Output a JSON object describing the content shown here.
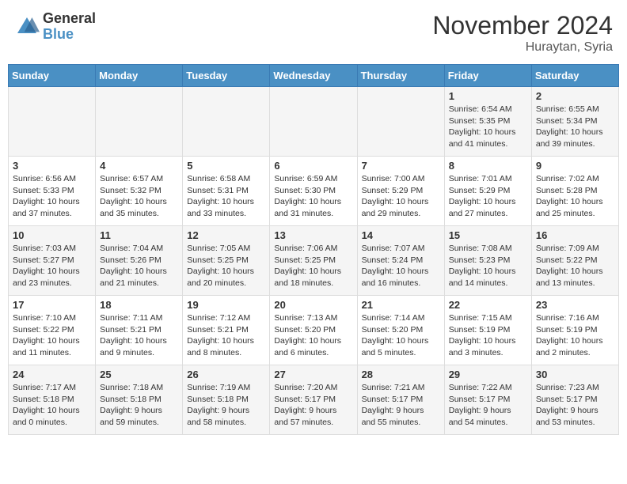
{
  "header": {
    "logo_general": "General",
    "logo_blue": "Blue",
    "month_title": "November 2024",
    "location": "Huraytan, Syria"
  },
  "weekdays": [
    "Sunday",
    "Monday",
    "Tuesday",
    "Wednesday",
    "Thursday",
    "Friday",
    "Saturday"
  ],
  "weeks": [
    [
      {
        "day": "",
        "info": ""
      },
      {
        "day": "",
        "info": ""
      },
      {
        "day": "",
        "info": ""
      },
      {
        "day": "",
        "info": ""
      },
      {
        "day": "",
        "info": ""
      },
      {
        "day": "1",
        "info": "Sunrise: 6:54 AM\nSunset: 5:35 PM\nDaylight: 10 hours and 41 minutes."
      },
      {
        "day": "2",
        "info": "Sunrise: 6:55 AM\nSunset: 5:34 PM\nDaylight: 10 hours and 39 minutes."
      }
    ],
    [
      {
        "day": "3",
        "info": "Sunrise: 6:56 AM\nSunset: 5:33 PM\nDaylight: 10 hours and 37 minutes."
      },
      {
        "day": "4",
        "info": "Sunrise: 6:57 AM\nSunset: 5:32 PM\nDaylight: 10 hours and 35 minutes."
      },
      {
        "day": "5",
        "info": "Sunrise: 6:58 AM\nSunset: 5:31 PM\nDaylight: 10 hours and 33 minutes."
      },
      {
        "day": "6",
        "info": "Sunrise: 6:59 AM\nSunset: 5:30 PM\nDaylight: 10 hours and 31 minutes."
      },
      {
        "day": "7",
        "info": "Sunrise: 7:00 AM\nSunset: 5:29 PM\nDaylight: 10 hours and 29 minutes."
      },
      {
        "day": "8",
        "info": "Sunrise: 7:01 AM\nSunset: 5:29 PM\nDaylight: 10 hours and 27 minutes."
      },
      {
        "day": "9",
        "info": "Sunrise: 7:02 AM\nSunset: 5:28 PM\nDaylight: 10 hours and 25 minutes."
      }
    ],
    [
      {
        "day": "10",
        "info": "Sunrise: 7:03 AM\nSunset: 5:27 PM\nDaylight: 10 hours and 23 minutes."
      },
      {
        "day": "11",
        "info": "Sunrise: 7:04 AM\nSunset: 5:26 PM\nDaylight: 10 hours and 21 minutes."
      },
      {
        "day": "12",
        "info": "Sunrise: 7:05 AM\nSunset: 5:25 PM\nDaylight: 10 hours and 20 minutes."
      },
      {
        "day": "13",
        "info": "Sunrise: 7:06 AM\nSunset: 5:25 PM\nDaylight: 10 hours and 18 minutes."
      },
      {
        "day": "14",
        "info": "Sunrise: 7:07 AM\nSunset: 5:24 PM\nDaylight: 10 hours and 16 minutes."
      },
      {
        "day": "15",
        "info": "Sunrise: 7:08 AM\nSunset: 5:23 PM\nDaylight: 10 hours and 14 minutes."
      },
      {
        "day": "16",
        "info": "Sunrise: 7:09 AM\nSunset: 5:22 PM\nDaylight: 10 hours and 13 minutes."
      }
    ],
    [
      {
        "day": "17",
        "info": "Sunrise: 7:10 AM\nSunset: 5:22 PM\nDaylight: 10 hours and 11 minutes."
      },
      {
        "day": "18",
        "info": "Sunrise: 7:11 AM\nSunset: 5:21 PM\nDaylight: 10 hours and 9 minutes."
      },
      {
        "day": "19",
        "info": "Sunrise: 7:12 AM\nSunset: 5:21 PM\nDaylight: 10 hours and 8 minutes."
      },
      {
        "day": "20",
        "info": "Sunrise: 7:13 AM\nSunset: 5:20 PM\nDaylight: 10 hours and 6 minutes."
      },
      {
        "day": "21",
        "info": "Sunrise: 7:14 AM\nSunset: 5:20 PM\nDaylight: 10 hours and 5 minutes."
      },
      {
        "day": "22",
        "info": "Sunrise: 7:15 AM\nSunset: 5:19 PM\nDaylight: 10 hours and 3 minutes."
      },
      {
        "day": "23",
        "info": "Sunrise: 7:16 AM\nSunset: 5:19 PM\nDaylight: 10 hours and 2 minutes."
      }
    ],
    [
      {
        "day": "24",
        "info": "Sunrise: 7:17 AM\nSunset: 5:18 PM\nDaylight: 10 hours and 0 minutes."
      },
      {
        "day": "25",
        "info": "Sunrise: 7:18 AM\nSunset: 5:18 PM\nDaylight: 9 hours and 59 minutes."
      },
      {
        "day": "26",
        "info": "Sunrise: 7:19 AM\nSunset: 5:18 PM\nDaylight: 9 hours and 58 minutes."
      },
      {
        "day": "27",
        "info": "Sunrise: 7:20 AM\nSunset: 5:17 PM\nDaylight: 9 hours and 57 minutes."
      },
      {
        "day": "28",
        "info": "Sunrise: 7:21 AM\nSunset: 5:17 PM\nDaylight: 9 hours and 55 minutes."
      },
      {
        "day": "29",
        "info": "Sunrise: 7:22 AM\nSunset: 5:17 PM\nDaylight: 9 hours and 54 minutes."
      },
      {
        "day": "30",
        "info": "Sunrise: 7:23 AM\nSunset: 5:17 PM\nDaylight: 9 hours and 53 minutes."
      }
    ]
  ]
}
